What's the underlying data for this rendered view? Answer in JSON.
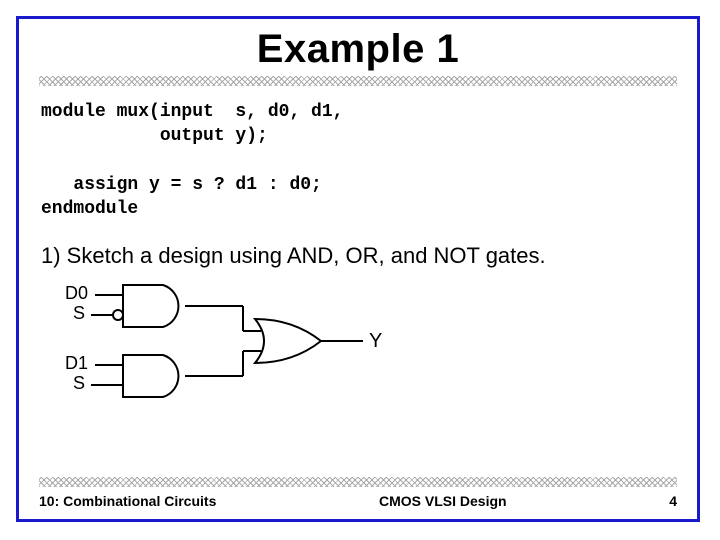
{
  "title": "Example 1",
  "code": {
    "l1": "module mux(input  s, d0, d1,",
    "l2": "           output y);",
    "l3": "",
    "l4": "   assign y = s ? d1 : d0;",
    "l5": "endmodule"
  },
  "question": "1) Sketch a design using AND, OR, and NOT gates.",
  "diagram": {
    "in1a": "D0",
    "in1b": "S",
    "in2a": "D1",
    "in2b": "S",
    "out": "Y"
  },
  "footer": {
    "left": "10: Combinational Circuits",
    "center": "CMOS VLSI Design",
    "page": "4"
  }
}
